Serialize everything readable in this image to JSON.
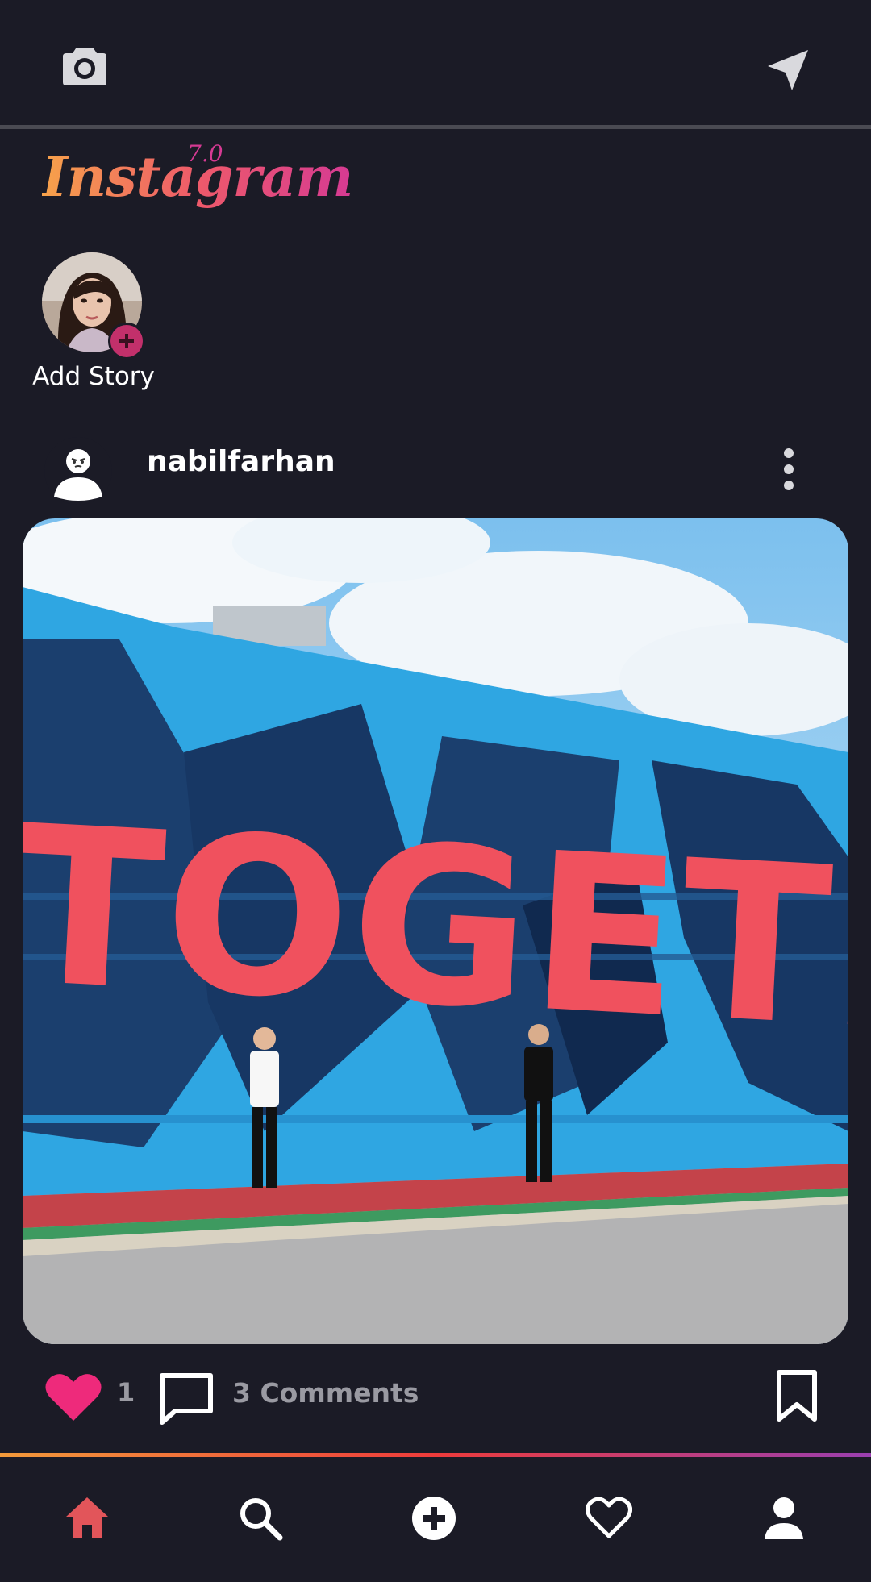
{
  "header": {
    "left_icon": "camera-icon",
    "right_icon": "send-icon"
  },
  "logo": {
    "text": "Instagram",
    "version": "7.0"
  },
  "stories": [
    {
      "label": "Add Story",
      "badge_icon": "plus-icon"
    }
  ],
  "post": {
    "username": "nabilfarhan",
    "more_icon": "more-vertical-icon",
    "image_text": "TOGETHER",
    "likes": "1",
    "comments": "3 Comments"
  },
  "nav": {
    "items": [
      "home-icon",
      "search-icon",
      "add-icon",
      "heart-icon",
      "profile-icon"
    ],
    "active": "home-icon"
  },
  "colors": {
    "background": "#1b1b26",
    "accent_pink": "#ee2a7b",
    "active_nav": "#e2555a",
    "muted_text": "#9a9aa2"
  }
}
